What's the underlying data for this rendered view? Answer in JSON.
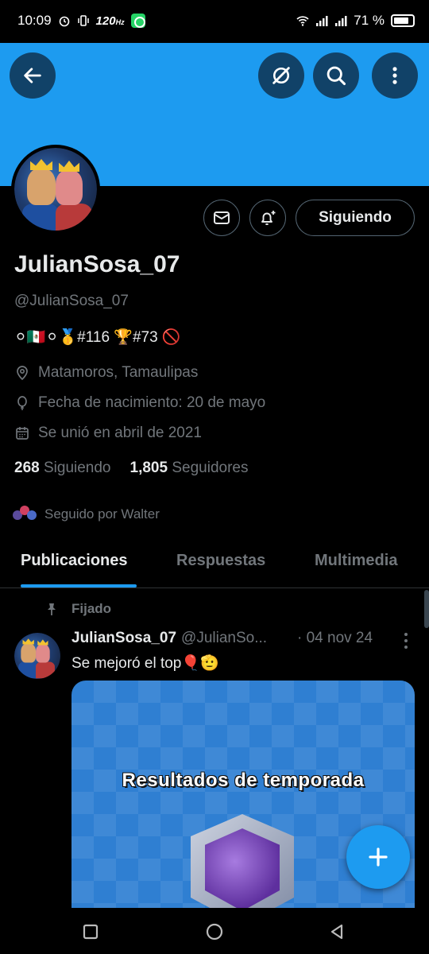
{
  "status_bar": {
    "time": "10:09",
    "refresh_rate": "120",
    "refresh_unit": "Hz",
    "battery": "71 %",
    "battery_level": 0.71
  },
  "header": {
    "back_icon": "arrow-left-icon",
    "grok_icon": "grok-icon",
    "search_icon": "search-icon",
    "more_icon": "more-vertical-icon"
  },
  "colors": {
    "accent": "#1d9bf0",
    "background": "#000000",
    "text_primary": "#e7e9ea",
    "text_secondary": "#71767b"
  },
  "profile": {
    "display_name": "JulianSosa_07",
    "handle": "@JulianSosa_07",
    "bio": "⚪🇲🇽⚪🥇#116 🏆#73 🚫",
    "location": "Matamoros, Tamaulipas",
    "birthday": "Fecha de nacimiento: 20 de mayo",
    "joined": "Se unió en abril de 2021",
    "following_count": "268",
    "following_label": "Siguiendo",
    "followers_count": "1,805",
    "followers_label": "Seguidores",
    "followed_by": "Seguido por Walter",
    "follow_button": "Siguiendo"
  },
  "tabs": [
    {
      "label": "Publicaciones",
      "active": true
    },
    {
      "label": "Respuestas",
      "active": false
    },
    {
      "label": "Multimedia",
      "active": false
    }
  ],
  "post": {
    "pinned_label": "Fijado",
    "author_name": "JulianSosa_07",
    "author_handle": "@JulianSo...",
    "date": "· 04 nov 24",
    "text": "Se mejoró el top🎈🫡",
    "media_title": "Resultados de temporada"
  }
}
